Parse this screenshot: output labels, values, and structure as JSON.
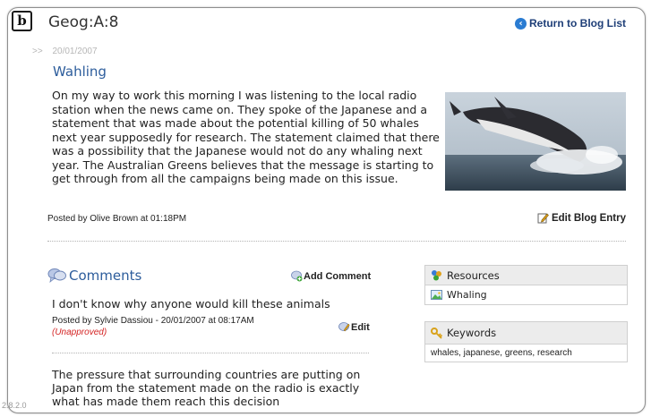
{
  "header": {
    "app_title": "Geog:A:8",
    "return_label": "Return to Blog List",
    "logo_letter": "b"
  },
  "post": {
    "date_arrows": ">>",
    "date": "20/01/2007",
    "title": "Wahling",
    "body": "On my way to work this morning I was listening to the local radio station when the news came on.  They spoke of the Japanese and a statement that was made about the potential killing of 50 whales next year supposedly for research.  The statement claimed that there was a possibility that the Japanese would not do any whaling next year.  The Australian Greens believes that the message is starting to get through from all the campaigns being made on this issue.",
    "posted_by": "Posted by Olive Brown at 01:18PM",
    "edit_label": "Edit Blog Entry"
  },
  "comments": {
    "heading": "Comments",
    "add_label": "Add Comment",
    "edit_label": "Edit",
    "items": [
      {
        "text": "I don't know why anyone would kill these animals",
        "meta": "Posted by Sylvie Dassiou - 20/01/2007 at 08:17AM",
        "status": "(Unapproved)"
      },
      {
        "text": "The pressure that surrounding countries are putting on Japan from the statement made on the radio is exactly what has made them reach this decision"
      }
    ]
  },
  "sidebar": {
    "resources_title": "Resources",
    "resource_item": "Whaling",
    "keywords_title": "Keywords",
    "keywords": "whales, japanese, greens, research"
  },
  "footer": {
    "version": "2.8.2.0"
  },
  "colors": {
    "accent": "#2d5d9c",
    "unapproved": "#d42323"
  }
}
